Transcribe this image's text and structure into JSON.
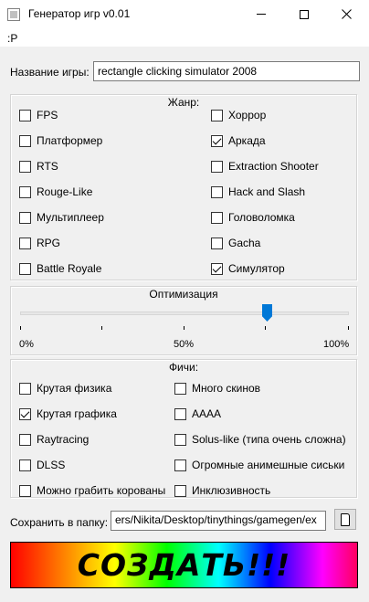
{
  "window": {
    "title": "Генератор игр v0.01"
  },
  "menu": {
    "item": ":P"
  },
  "name": {
    "label": "Название игры:",
    "value": "rectangle clicking simulator 2008"
  },
  "genre": {
    "title": "Жанр:",
    "items": [
      {
        "label": "FPS",
        "checked": false
      },
      {
        "label": "Платформер",
        "checked": false
      },
      {
        "label": "RTS",
        "checked": false
      },
      {
        "label": "Rouge-Like",
        "checked": false
      },
      {
        "label": "Мультиплеер",
        "checked": false
      },
      {
        "label": "RPG",
        "checked": false
      },
      {
        "label": "Battle Royale",
        "checked": false
      },
      {
        "label": "Хоррор",
        "checked": false
      },
      {
        "label": "Аркада",
        "checked": true
      },
      {
        "label": "Extraction Shooter",
        "checked": false
      },
      {
        "label": "Hack and Slash",
        "checked": false
      },
      {
        "label": "Головоломка",
        "checked": false
      },
      {
        "label": "Gacha",
        "checked": false
      },
      {
        "label": "Симулятор",
        "checked": true
      }
    ]
  },
  "optimization": {
    "title": "Оптимизация",
    "value_percent": 75,
    "labels": {
      "min": "0%",
      "mid": "50%",
      "max": "100%"
    }
  },
  "features": {
    "title": "Фичи:",
    "items": [
      {
        "label": "Крутая физика",
        "checked": false
      },
      {
        "label": "Крутая графика",
        "checked": true
      },
      {
        "label": "Raytracing",
        "checked": false
      },
      {
        "label": "DLSS",
        "checked": false
      },
      {
        "label": "Можно грабить корованы",
        "checked": false
      },
      {
        "label": "Много скинов",
        "checked": false
      },
      {
        "label": "AAAA",
        "checked": false
      },
      {
        "label": "Solus-like (типа очень сложна)",
        "checked": false
      },
      {
        "label": "Огромные анимешные сиськи",
        "checked": false
      },
      {
        "label": "Инклюзивность",
        "checked": false
      }
    ]
  },
  "save": {
    "label": "Сохранить в папку:",
    "path": "ers/Nikita/Desktop/tinythings/gamegen/ex"
  },
  "create": {
    "label": "СОЗДАТЬ!!!"
  },
  "icons": {
    "browse": "folder-icon",
    "close": "close-icon",
    "maximize": "maximize-icon",
    "minimize": "minimize-icon"
  },
  "colors": {
    "accent": "#0078d7"
  }
}
